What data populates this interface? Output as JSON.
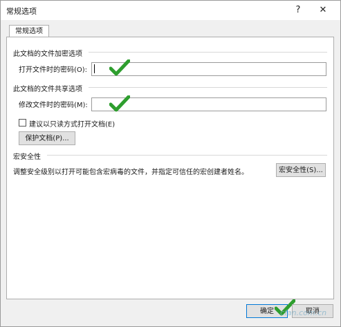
{
  "window": {
    "title": "常规选项",
    "help_label": "?",
    "close_label": "✕"
  },
  "tabs": [
    {
      "label": "常规选项"
    }
  ],
  "encryption": {
    "section_title": "此文档的文件加密选项",
    "open_password_label": "打开文件时的密码(O):",
    "open_password_value": ""
  },
  "sharing": {
    "section_title": "此文档的文件共享选项",
    "modify_password_label": "修改文件时的密码(M):",
    "modify_password_value": "",
    "readonly_label": "建议以只读方式打开文档(E)",
    "protect_button": "保护文档(P)..."
  },
  "macro": {
    "section_title": "宏安全性",
    "description": "调整安全级别以打开可能包含宏病毒的文件，并指定可信任的宏创建者姓名。",
    "button": "宏安全性(S)..."
  },
  "footer": {
    "ok_label": "确定",
    "cancel_label": "取消"
  },
  "watermark": "cfan.com.cn",
  "icons": {
    "annotation": "green-checkmark-icon",
    "annotation_color": "#2e9e2e"
  }
}
